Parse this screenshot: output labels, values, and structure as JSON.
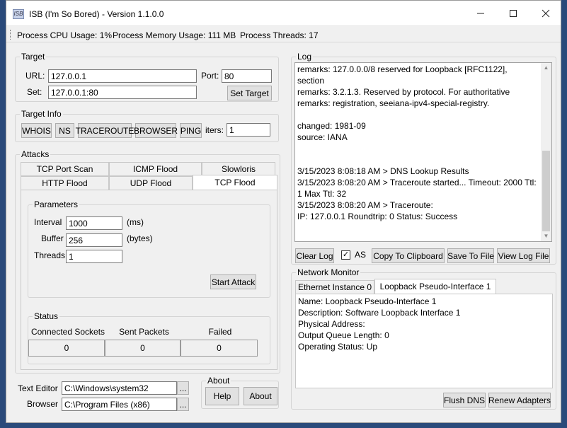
{
  "window": {
    "title": "ISB (I'm So Bored) - Version 1.1.0.0",
    "icon_text": "ISB"
  },
  "statusbar": {
    "cpu": "Process CPU Usage: 1%",
    "memory": "Process Memory Usage: 111 MB",
    "threads": "Process Threads: 17"
  },
  "target": {
    "legend": "Target",
    "url_label": "URL:",
    "url_value": "127.0.0.1",
    "port_label": "Port:",
    "port_value": "80",
    "set_label": "Set:",
    "set_value": "127.0.0.1:80",
    "set_target_button": "Set Target"
  },
  "target_info": {
    "legend": "Target Info",
    "buttons": [
      "WHOIS",
      "NS",
      "TRACEROUTE",
      "BROWSER",
      "PING"
    ],
    "iters_label": "iters:",
    "iters_value": "1"
  },
  "attacks": {
    "legend": "Attacks",
    "tabs_row1": [
      "TCP Port Scan",
      "ICMP Flood",
      "Slowloris"
    ],
    "tabs_row2": [
      "HTTP Flood",
      "UDP Flood",
      "TCP Flood"
    ],
    "active_tab": "TCP Flood",
    "parameters": {
      "legend": "Parameters",
      "interval_label": "Interval",
      "interval_value": "1000",
      "interval_unit": "(ms)",
      "buffer_label": "Buffer",
      "buffer_value": "256",
      "buffer_unit": "(bytes)",
      "threads_label": "Threads",
      "threads_value": "1",
      "start_button": "Start Attack"
    },
    "status": {
      "legend": "Status",
      "columns": [
        "Connected Sockets",
        "Sent Packets",
        "Failed"
      ],
      "values": [
        "0",
        "0",
        "0"
      ]
    }
  },
  "bottom": {
    "text_editor_label": "Text Editor",
    "text_editor_value": "C:\\Windows\\system32",
    "browser_label": "Browser",
    "browser_value": "C:\\Program Files (x86)",
    "browse_button": "...",
    "about_legend": "About",
    "help_button": "Help",
    "about_button": "About"
  },
  "log": {
    "legend": "Log",
    "lines": [
      "remarks:      127.0.0.0/8 reserved for Loopback [RFC1122],",
      "section",
      "remarks:      3.2.1.3. Reserved by protocol. For authoritative",
      "remarks:      registration, seeiana-ipv4-special-registry.",
      "",
      "changed:      1981-09",
      "source:       IANA",
      "",
      "",
      "3/15/2023 8:08:18 AM > DNS Lookup Results",
      "3/15/2023 8:08:20 AM > Traceroute started... Timeout: 2000 Ttl:",
      "1 Max Ttl: 32",
      "3/15/2023 8:08:20 AM > Traceroute:",
      "IP: 127.0.0.1 Roundtrip: 0 Status: Success"
    ],
    "clear_button": "Clear Log",
    "as_label": "AS",
    "as_checked": true,
    "copy_button": "Copy To Clipboard",
    "save_button": "Save To File",
    "view_button": "View Log File"
  },
  "network_monitor": {
    "legend": "Network Monitor",
    "tabs": [
      "Ethernet Instance 0",
      "Loopback Pseudo-Interface 1"
    ],
    "active_tab": "Loopback Pseudo-Interface 1",
    "lines": [
      "Name: Loopback Pseudo-Interface 1",
      "Description: Software Loopback Interface 1",
      "Physical Address:",
      "Output Queue Length: 0",
      "Operating Status: Up"
    ],
    "flush_button": "Flush DNS",
    "renew_button": "Renew Adapters"
  },
  "colors": {
    "window_bg": "#f0f0f0",
    "desktop_bg": "#2a4a7a",
    "button_bg": "#e1e1e1"
  }
}
